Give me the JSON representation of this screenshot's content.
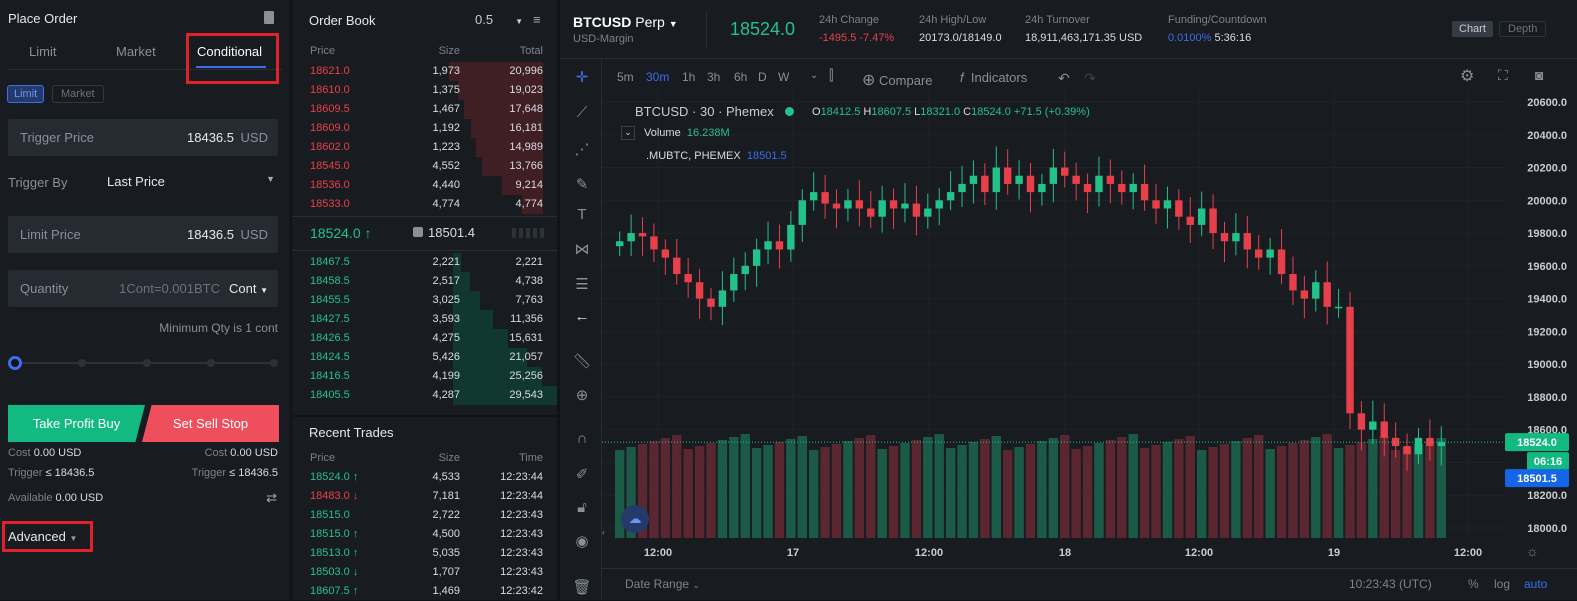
{
  "colors": {
    "up": "#23c28a",
    "down": "#e8404a",
    "accent": "#3d6ee8",
    "bg": "#181b20",
    "highlight_box": "#e0202a"
  },
  "order": {
    "title": "Place Order",
    "calculator_icon": "calculator-icon",
    "tabs": [
      "Limit",
      "Market",
      "Conditional"
    ],
    "active_tab": "Conditional",
    "subtabs": [
      "Limit",
      "Market"
    ],
    "active_subtab": "Limit",
    "trigger_price": {
      "label": "Trigger Price",
      "value": "18436.5",
      "unit": "USD"
    },
    "trigger_by": {
      "label": "Trigger By",
      "value": "Last Price"
    },
    "limit_price": {
      "label": "Limit Price",
      "value": "18436.5",
      "unit": "USD"
    },
    "quantity": {
      "label": "Quantity",
      "hint": "1Cont=0.001BTC",
      "unit": "Cont"
    },
    "min_qty": "Minimum Qty is 1 cont",
    "slider_percent": 0,
    "buy_label": "Take Profit Buy",
    "sell_label": "Set Sell Stop",
    "cost_label": "Cost",
    "buy_cost": "0.00 USD",
    "sell_cost": "0.00 USD",
    "trigger_label": "Trigger",
    "buy_trigger": "≤ 18436.5",
    "sell_trigger": "≤ 18436.5",
    "available_label": "Available",
    "available": "0.00 USD",
    "advanced": "Advanced"
  },
  "orderbook": {
    "title": "Order Book",
    "precision": "0.5",
    "headers": [
      "Price",
      "Size",
      "Total"
    ],
    "asks": [
      [
        "18621.0",
        "1,973",
        "20,996"
      ],
      [
        "18610.0",
        "1,375",
        "19,023"
      ],
      [
        "18609.5",
        "1,467",
        "17,648"
      ],
      [
        "18609.0",
        "1,192",
        "16,181"
      ],
      [
        "18602.0",
        "1,223",
        "14,989"
      ],
      [
        "18545.0",
        "4,552",
        "13,766"
      ],
      [
        "18536.0",
        "4,440",
        "9,214"
      ],
      [
        "18533.0",
        "4,774",
        "4,774"
      ]
    ],
    "last": "18524.0 ↑",
    "mark": "18501.4",
    "bids": [
      [
        "18467.5",
        "2,221",
        "2,221"
      ],
      [
        "18458.5",
        "2,517",
        "4,738"
      ],
      [
        "18455.5",
        "3,025",
        "7,763"
      ],
      [
        "18427.5",
        "3,593",
        "11,356"
      ],
      [
        "18426.5",
        "4,275",
        "15,631"
      ],
      [
        "18424.5",
        "5,426",
        "21,057"
      ],
      [
        "18416.5",
        "4,199",
        "25,256"
      ],
      [
        "18405.5",
        "4,287",
        "29,543"
      ]
    ]
  },
  "trades": {
    "title": "Recent Trades",
    "headers": [
      "Price",
      "Size",
      "Time"
    ],
    "rows": [
      [
        "18524.0 ↑",
        "4,533",
        "12:23:44",
        "up"
      ],
      [
        "18483.0 ↓",
        "7,181",
        "12:23:44",
        "down"
      ],
      [
        "18515.0",
        "2,722",
        "12:23:43",
        "up"
      ],
      [
        "18515.0 ↑",
        "4,500",
        "12:23:43",
        "up"
      ],
      [
        "18513.0 ↑",
        "5,035",
        "12:23:43",
        "up"
      ],
      [
        "18503.0 ↓",
        "1,707",
        "12:23:43",
        "up"
      ],
      [
        "18607.5 ↑",
        "1,469",
        "12:23:42",
        "up"
      ]
    ]
  },
  "ticker": {
    "symbol": "BTCUSD",
    "type": "Perp",
    "margin": "USD-Margin",
    "price": "18524.0",
    "change_label": "24h Change",
    "change": "-1495.5 -7.47%",
    "hl_label": "24h High/Low",
    "hl": "20173.0/18149.0",
    "turnover_label": "24h Turnover",
    "turnover": "18,911,463,171.35 USD",
    "funding_label": "Funding/Countdown",
    "funding_rate": "0.0100%",
    "countdown": "5:36:16",
    "view_tabs": [
      "Chart",
      "Depth"
    ]
  },
  "toolbar": {
    "intervals": [
      "5m",
      "30m",
      "1h",
      "3h",
      "6h",
      "D",
      "W"
    ],
    "active": "30m",
    "compare": "Compare",
    "indicators": "Indicators"
  },
  "legend": {
    "title": "BTCUSD · 30 · Phemex",
    "o": "18412.5",
    "h": "18607.5",
    "l": "18321.0",
    "c": "18524.0",
    "chg": "+71.5 (+0.39%)",
    "volume_label": "Volume",
    "volume": "16.238M",
    "mark_label": ".MUBTC, PHEMEX",
    "mark": "18501.5"
  },
  "footer": {
    "date_range": "Date Range",
    "clock": "10:23:43 (UTC)",
    "pct": "%",
    "log": "log",
    "auto": "auto"
  },
  "chart_data": {
    "type": "candlestick",
    "interval": "30m",
    "ylim": [
      18000,
      20600
    ],
    "yticks": [
      "20600.0",
      "20400.0",
      "20200.0",
      "20000.0",
      "19800.0",
      "19600.0",
      "19400.0",
      "19200.0",
      "19000.0",
      "18800.0",
      "18600.0",
      "18400.0",
      "18200.0",
      "18000.0"
    ],
    "xticks": [
      "12:00",
      "17",
      "12:00",
      "18",
      "12:00",
      "19",
      "12:00"
    ],
    "last_price_label": "18524.0",
    "countdown_label": "06:16",
    "mark_price_label": "18501.5",
    "closes": [
      19750,
      19800,
      19780,
      19700,
      19650,
      19550,
      19500,
      19400,
      19350,
      19450,
      19550,
      19600,
      19700,
      19750,
      19700,
      19850,
      20000,
      20050,
      19980,
      19950,
      20000,
      19950,
      19900,
      20000,
      19950,
      19980,
      19900,
      19950,
      20000,
      20050,
      20100,
      20150,
      20050,
      20200,
      20100,
      20150,
      20050,
      20100,
      20200,
      20150,
      20100,
      20050,
      20150,
      20100,
      20050,
      20100,
      20000,
      19950,
      20000,
      19900,
      19850,
      19950,
      19800,
      19750,
      19800,
      19700,
      19650,
      19700,
      19550,
      19450,
      19400,
      19500,
      19350,
      19350,
      18700,
      18600,
      18650,
      18550,
      18500,
      18450,
      18550,
      18500,
      18524
    ]
  }
}
